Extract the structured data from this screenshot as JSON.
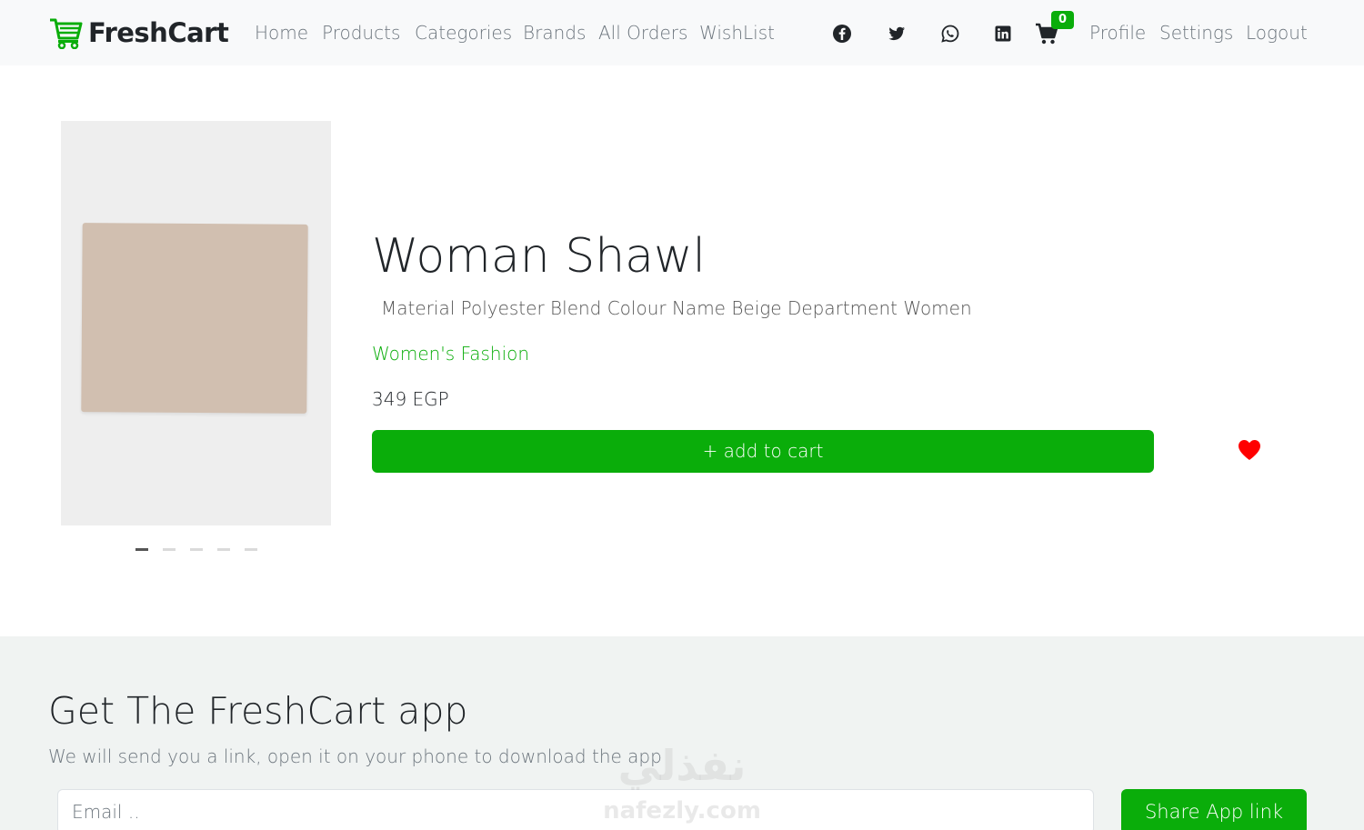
{
  "navbar": {
    "brand": "FreshCart",
    "links": [
      "Home",
      "Products",
      "Categories",
      "Brands",
      "All Orders",
      "WishList"
    ],
    "cart_count": "0",
    "right_links": [
      "Profile",
      "Settings",
      "Logout"
    ]
  },
  "product": {
    "title": "Woman Shawl",
    "description": "Material Polyester Blend Colour Name Beige Department Women",
    "category": "Women's Fashion",
    "price": "349 EGP",
    "add_to_cart": "+ add to cart",
    "slide_count": 5,
    "active_slide": 1
  },
  "footer": {
    "title": "Get The FreshCart app",
    "subtitle": "We will send you a link, open it on your phone to download the app",
    "email_placeholder": "Email ..",
    "share_button": "Share App link"
  },
  "watermark": {
    "arabic": "نفذلي",
    "latin": "nafezly.com"
  },
  "colors": {
    "accent": "#0aad0a",
    "heart": "#ff0000",
    "navbar_bg": "#f8f9fa",
    "footer_bg": "#f0f3f2"
  }
}
